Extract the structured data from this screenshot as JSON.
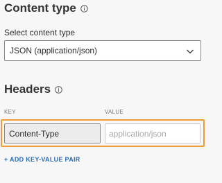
{
  "content_type": {
    "title": "Content type",
    "title_icon": "info-icon",
    "select_label": "Select content type",
    "selected_value": "JSON (application/json)",
    "dropdown_icon": "chevron-down-icon"
  },
  "headers": {
    "title": "Headers",
    "title_icon": "info-icon",
    "key_column": "KEY",
    "value_column": "VALUE",
    "rows": [
      {
        "key": "Content-Type",
        "value": "",
        "value_placeholder": "application/json"
      }
    ],
    "add_pair_label": "+ ADD KEY-VALUE PAIR"
  },
  "colors": {
    "highlight": "#f09a36",
    "link": "#2b6cb0",
    "background": "#f7f7f7"
  }
}
